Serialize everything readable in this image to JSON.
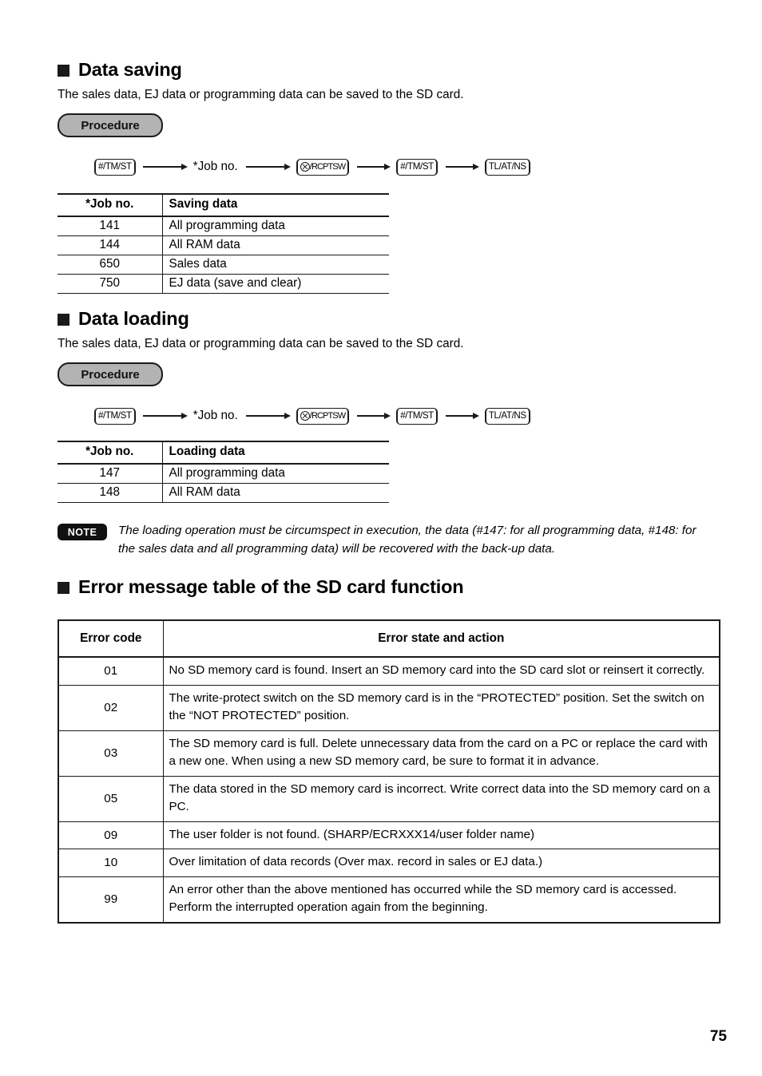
{
  "page": {
    "number": "75"
  },
  "sections": {
    "data_saving": {
      "heading": "Data saving",
      "intro": "The sales data, EJ data or programming data can be saved to the SD card.",
      "procedure_label": "Procedure",
      "flow": [
        {
          "type": "key",
          "label": "#/TM/ST"
        },
        {
          "type": "text",
          "label": "*Job no."
        },
        {
          "type": "key_circle_x",
          "label": "/RCPTSW"
        },
        {
          "type": "key",
          "label": "#/TM/ST"
        },
        {
          "type": "key",
          "label": "TL/AT/NS"
        }
      ],
      "table": {
        "headers": [
          "*Job no.",
          "Saving data"
        ],
        "rows": [
          [
            "141",
            "All programming data"
          ],
          [
            "144",
            "All RAM data"
          ],
          [
            "650",
            "Sales data"
          ],
          [
            "750",
            "EJ data (save and clear)"
          ]
        ]
      }
    },
    "data_loading": {
      "heading": "Data loading",
      "intro": "The sales data, EJ data or programming data can be saved to the SD card.",
      "procedure_label": "Procedure",
      "flow": [
        {
          "type": "key",
          "label": "#/TM/ST"
        },
        {
          "type": "text",
          "label": "*Job no."
        },
        {
          "type": "key_circle_x",
          "label": "/RCPTSW"
        },
        {
          "type": "key",
          "label": "#/TM/ST"
        },
        {
          "type": "key",
          "label": "TL/AT/NS"
        }
      ],
      "table": {
        "headers": [
          "*Job no.",
          "Loading data"
        ],
        "rows": [
          [
            "147",
            "All programming data"
          ],
          [
            "148",
            "All RAM data"
          ]
        ]
      }
    },
    "note": {
      "badge": "NOTE",
      "text": "The loading operation must be circumspect in execution, the data (#147: for all programming data, #148: for the sales data and all programming data) will be recovered with the back-up data."
    },
    "error_table_section": {
      "heading": "Error message table of the SD card function",
      "table": {
        "headers": [
          "Error code",
          "Error state and action"
        ],
        "rows": [
          [
            "01",
            "No SD memory card is found. Insert an SD memory card into the SD card slot or reinsert it correctly."
          ],
          [
            "02",
            "The write-protect switch on the SD memory card is in the “PROTECTED” position. Set the switch on the “NOT PROTECTED” position."
          ],
          [
            "03",
            "The SD memory card is full. Delete unnecessary data from the card on a PC or replace the card with a new one. When using a new SD memory card, be sure to format it in advance."
          ],
          [
            "05",
            "The data stored in the SD memory card is incorrect. Write correct data into the SD memory card on a PC."
          ],
          [
            "09",
            "The user folder is not found. (SHARP/ECRXXX14/user folder name)"
          ],
          [
            "10",
            "Over limitation of data records (Over max. record in sales or EJ data.)"
          ],
          [
            "99",
            "An error other than the above mentioned has occurred while the SD memory card is accessed. Perform the interrupted operation again from the beginning."
          ]
        ]
      }
    }
  },
  "colors": {
    "ink": "#1a1a1a",
    "procedure_fill": "#b3b3b3",
    "note_fill": "#111111"
  }
}
